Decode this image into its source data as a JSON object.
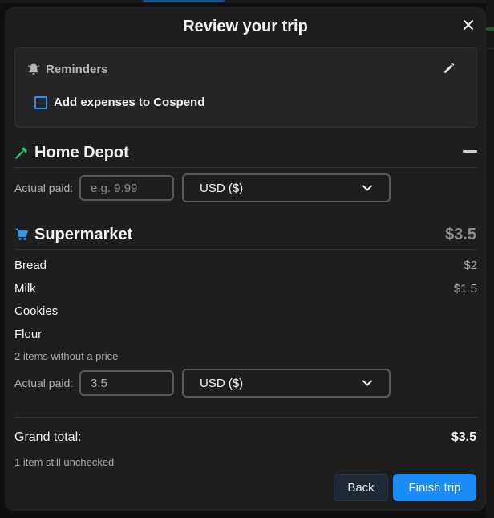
{
  "modal": {
    "title": "Review your trip",
    "close_icon": "close-icon"
  },
  "reminders": {
    "title": "Reminders",
    "icon": "bell-icon",
    "edit_icon": "pencil-icon",
    "checkbox_label": "Add expenses to Cospend",
    "checkbox_checked": false
  },
  "stores": [
    {
      "name": "Home Depot",
      "icon": "hammer-icon",
      "icon_color": "#2fbf71",
      "collapsed": true,
      "collapse_icon": "minus-icon",
      "actual_paid_label": "Actual paid:",
      "actual_paid_value": "",
      "actual_paid_placeholder": "e.g. 9.99",
      "currency": "USD ($)"
    },
    {
      "name": "Supermarket",
      "icon": "cart-icon",
      "icon_color": "#2f9bf0",
      "total": "$3.5",
      "items": [
        {
          "name": "Bread",
          "price": "$2"
        },
        {
          "name": "Milk",
          "price": "$1.5"
        },
        {
          "name": "Cookies",
          "price": ""
        },
        {
          "name": "Flour",
          "price": ""
        }
      ],
      "note": "2 items without a price",
      "actual_paid_label": "Actual paid:",
      "actual_paid_value": "3.5",
      "actual_paid_placeholder": "",
      "currency": "USD ($)"
    }
  ],
  "summary": {
    "grand_total_label": "Grand total:",
    "grand_total_value": "$3.5",
    "unchecked_note": "1 item still unchecked"
  },
  "actions": {
    "back_label": "Back",
    "finish_label": "Finish trip"
  },
  "colors": {
    "accent": "#1a8cf5",
    "background": "#1e1e1f"
  }
}
